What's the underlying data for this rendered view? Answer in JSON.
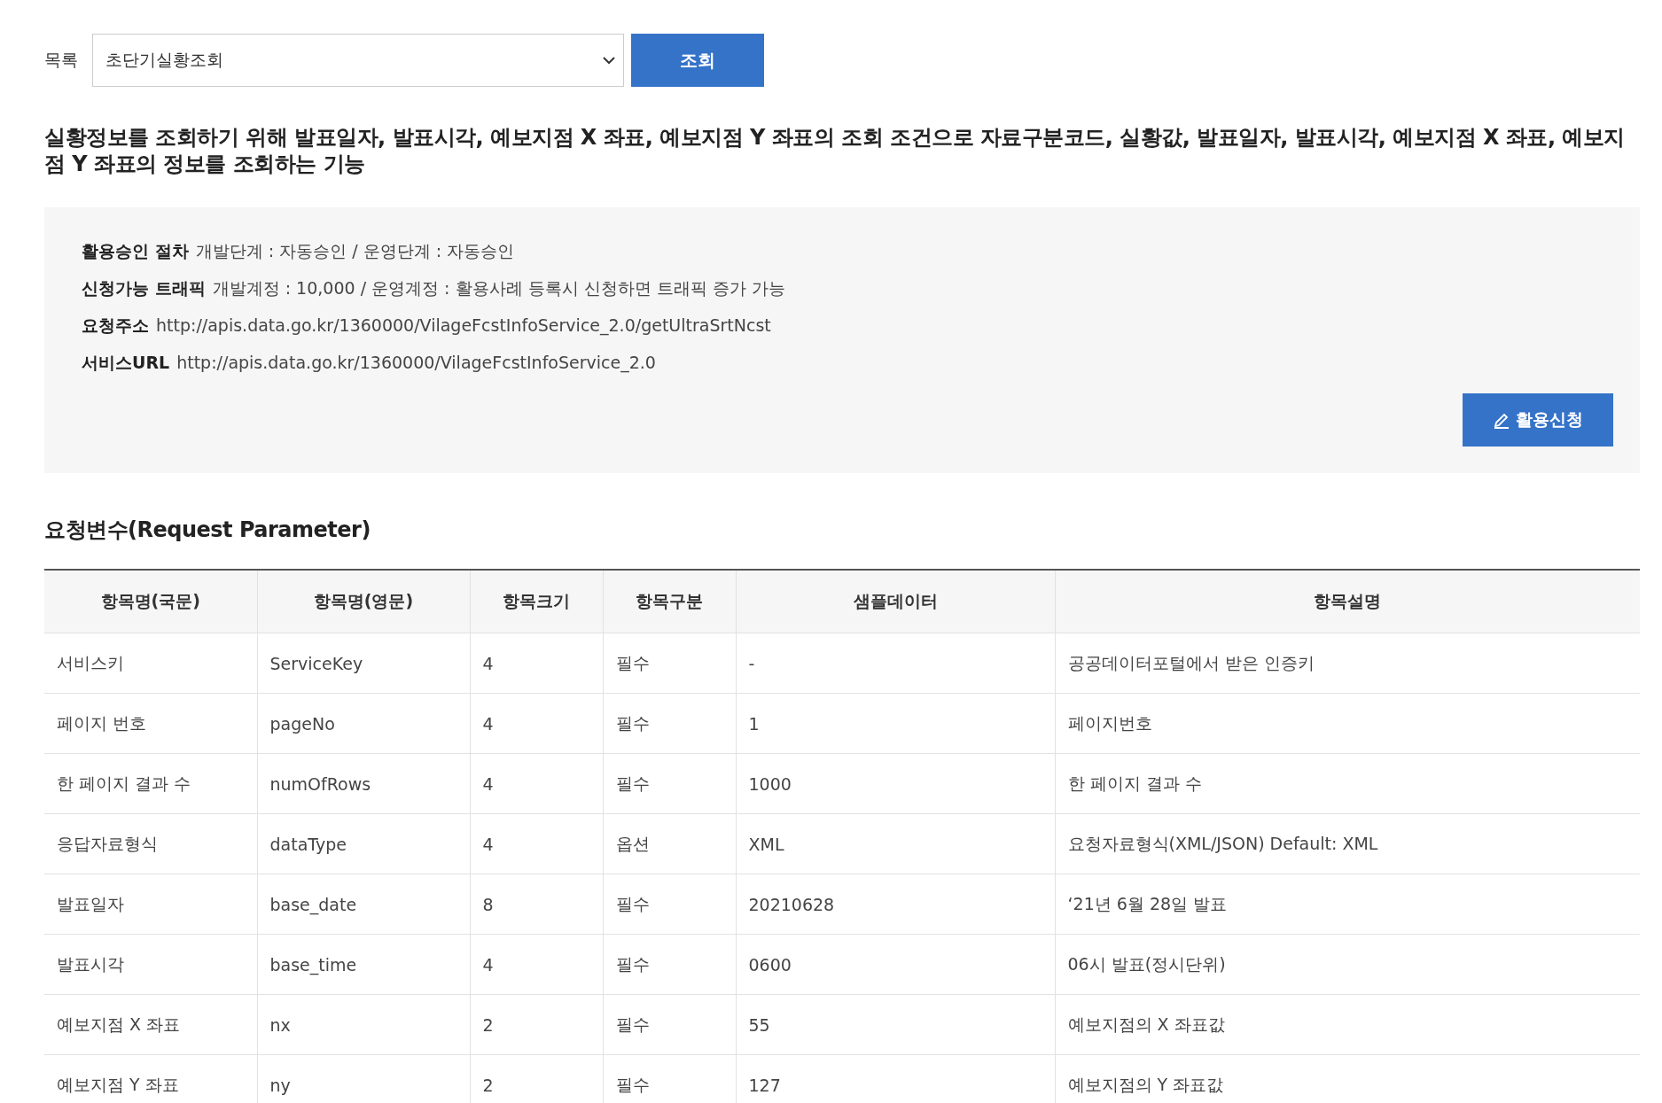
{
  "filter": {
    "label": "목록",
    "select_value": "초단기실황조회",
    "button": "조회"
  },
  "description": "실황정보를 조회하기 위해 발표일자, 발표시각, 예보지점 X 좌표, 예보지점 Y 좌표의 조회 조건으로 자료구분코드, 실황값, 발표일자, 발표시각, 예보지점 X 좌표, 예보지점 Y 좌표의 정보를 조회하는 기능",
  "info": {
    "rows": [
      {
        "label": "활용승인 절차",
        "value": "개발단계 : 자동승인 / 운영단계 : 자동승인"
      },
      {
        "label": "신청가능 트래픽",
        "value": "개발계정 : 10,000 / 운영계정 : 활용사례 등록시 신청하면 트래픽 증가 가능"
      },
      {
        "label": "요청주소",
        "value": "http://apis.data.go.kr/1360000/VilageFcstInfoService_2.0/getUltraSrtNcst"
      },
      {
        "label": "서비스URL",
        "value": "http://apis.data.go.kr/1360000/VilageFcstInfoService_2.0"
      }
    ],
    "button": "활용신청"
  },
  "section_title": "요청변수(Request Parameter)",
  "table": {
    "columns": [
      "항목명(국문)",
      "항목명(영문)",
      "항목크기",
      "항목구분",
      "샘플데이터",
      "항목설명"
    ],
    "rows": [
      [
        "서비스키",
        "ServiceKey",
        "4",
        "필수",
        "-",
        "공공데이터포털에서 받은 인증키"
      ],
      [
        "페이지 번호",
        "pageNo",
        "4",
        "필수",
        "1",
        "페이지번호"
      ],
      [
        "한 페이지 결과 수",
        "numOfRows",
        "4",
        "필수",
        "1000",
        "한 페이지 결과 수"
      ],
      [
        "응답자료형식",
        "dataType",
        "4",
        "옵션",
        "XML",
        "요청자료형식(XML/JSON) Default: XML"
      ],
      [
        "발표일자",
        "base_date",
        "8",
        "필수",
        "20210628",
        "‘21년 6월 28일 발표"
      ],
      [
        "발표시각",
        "base_time",
        "4",
        "필수",
        "0600",
        "06시 발표(정시단위)"
      ],
      [
        "예보지점 X 좌표",
        "nx",
        "2",
        "필수",
        "55",
        "예보지점의 X 좌표값"
      ],
      [
        "예보지점 Y 좌표",
        "ny",
        "2",
        "필수",
        "127",
        "예보지점의 Y 좌표값"
      ]
    ]
  }
}
